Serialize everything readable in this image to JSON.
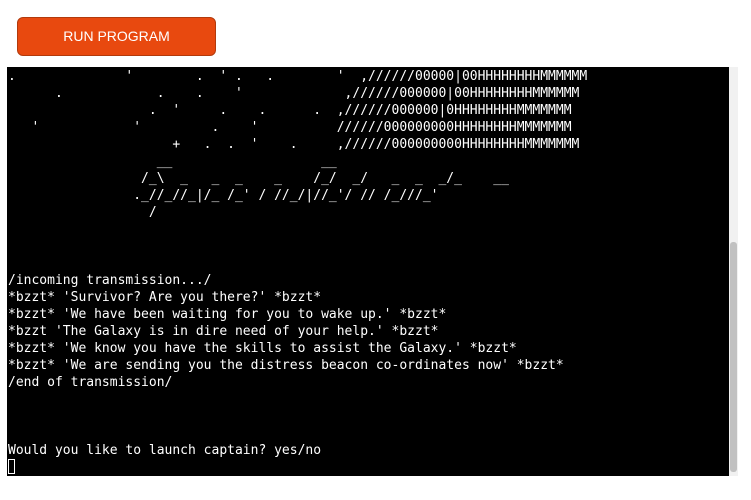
{
  "toolbar": {
    "run_label": "RUN PROGRAM",
    "run_color": "#e8490f"
  },
  "terminal": {
    "background": "#000000",
    "foreground": "#ffffff",
    "art_lines": [
      ".              '        .  ' .   .        '  ,//////00000|00HHHHHHHHMMMMMM",
      "      .            .    .    '             ,//////000000|00HHHHHHHHMMMMMM",
      "                  .  '     .    .      .  ,//////000000|0HHHHHHHHMMMMMMM",
      "   '            '         .    '          //////000000000HHHHHHHHMMMMMMM",
      "                     +   .  .  '    .     ,//////000000000HHHHHHHHMMMMMMM",
      "                   __                   __",
      "                 /_\\  _   _  _    _    /_/  _/   _  _  _/_    __",
      "                ._//_//_|/_ /_' / //_/|//_'/ // /_///_'",
      "                  /"
    ],
    "transmission_lines": [
      "/incoming transmission.../",
      "*bzzt* 'Survivor? Are you there?' *bzzt*",
      "*bzzt* 'We have been waiting for you to wake up.' *bzzt*",
      "*bzzt 'The Galaxy is in dire need of your help.' *bzzt*",
      "*bzzt* 'We know you have the skills to assist the Galaxy.' *bzzt*",
      "*bzzt* 'We are sending you the distress beacon co-ordinates now' *bzzt*",
      "/end of transmission/"
    ],
    "prompt": "Would you like to launch captain? yes/no"
  }
}
